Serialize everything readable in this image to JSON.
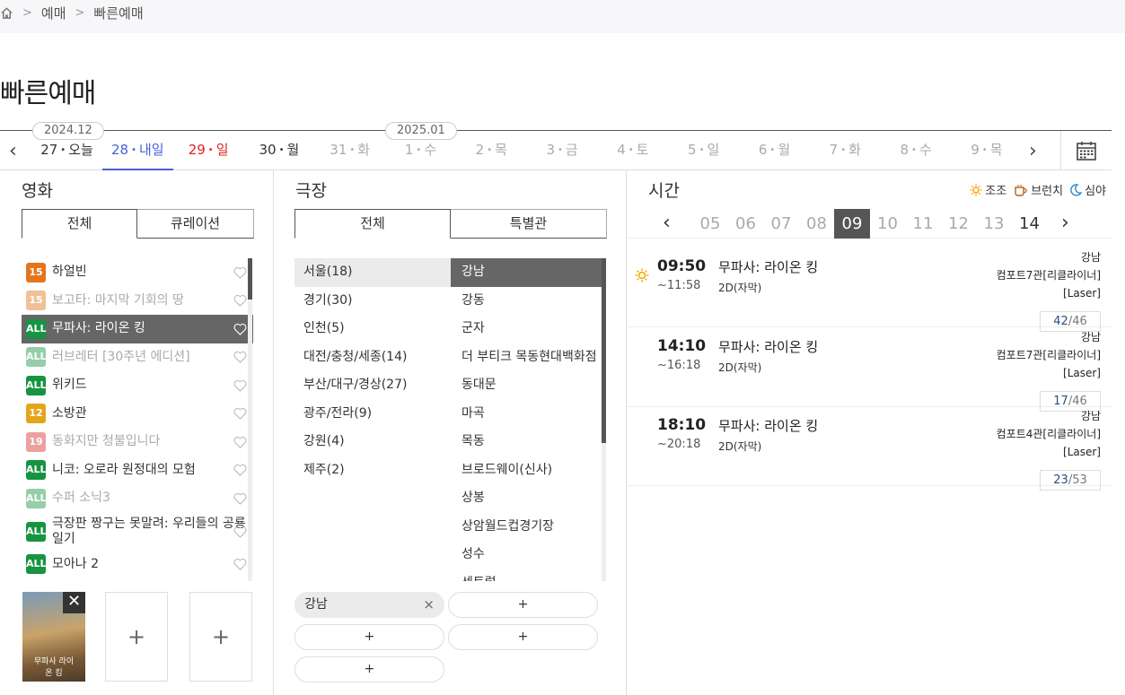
{
  "breadcrumb": [
    "예매",
    "빠른예매"
  ],
  "page_title": "빠른예매",
  "date_strip": {
    "months": [
      "2024.12",
      "2025.01"
    ],
    "days": [
      {
        "num": "27",
        "dow": "오늘",
        "state": "normal"
      },
      {
        "num": "28",
        "dow": "내일",
        "state": "sel"
      },
      {
        "num": "29",
        "dow": "일",
        "state": "sun"
      },
      {
        "num": "30",
        "dow": "월",
        "state": "normal"
      },
      {
        "num": "31",
        "dow": "화",
        "state": "dis"
      },
      {
        "num": "1",
        "dow": "수",
        "state": "dis"
      },
      {
        "num": "2",
        "dow": "목",
        "state": "dis"
      },
      {
        "num": "3",
        "dow": "금",
        "state": "dis"
      },
      {
        "num": "4",
        "dow": "토",
        "state": "dis"
      },
      {
        "num": "5",
        "dow": "일",
        "state": "dis"
      },
      {
        "num": "6",
        "dow": "월",
        "state": "dis"
      },
      {
        "num": "7",
        "dow": "화",
        "state": "dis"
      },
      {
        "num": "8",
        "dow": "수",
        "state": "dis"
      },
      {
        "num": "9",
        "dow": "목",
        "state": "dis"
      }
    ]
  },
  "movie_section": {
    "title": "영화",
    "tabs": [
      "전체",
      "큐레이션"
    ],
    "movies": [
      {
        "rating": "15",
        "name": "하얼빈",
        "state": "normal"
      },
      {
        "rating": "15",
        "name": "보고타: 마지막 기회의 땅",
        "state": "dim"
      },
      {
        "rating": "ALL",
        "name": "무파사: 라이온 킹",
        "state": "sel"
      },
      {
        "rating": "ALL",
        "name": "러브레터 [30주년 에디션]",
        "state": "dim"
      },
      {
        "rating": "ALL",
        "name": "위키드",
        "state": "normal"
      },
      {
        "rating": "12",
        "name": "소방관",
        "state": "normal"
      },
      {
        "rating": "19",
        "name": "동화지만 청불입니다",
        "state": "dim"
      },
      {
        "rating": "ALL",
        "name": "니코: 오로라 원정대의 모험",
        "state": "normal"
      },
      {
        "rating": "ALL",
        "name": "수퍼 소닉3",
        "state": "dim"
      },
      {
        "rating": "ALL",
        "name": "극장판 짱구는 못말려: 우리들의 공룡일기",
        "state": "normal"
      },
      {
        "rating": "ALL",
        "name": "모아나 2",
        "state": "normal"
      }
    ],
    "poster_title": "무파사 라이온 킹",
    "close_label": "✕",
    "add_label": "+"
  },
  "theater_section": {
    "title": "극장",
    "tabs": [
      "전체",
      "특별관"
    ],
    "regions": [
      "서울(18)",
      "경기(30)",
      "인천(5)",
      "대전/충청/세종(14)",
      "부산/대구/경상(27)",
      "광주/전라(9)",
      "강원(4)",
      "제주(2)"
    ],
    "branches": [
      "강남",
      "강동",
      "군자",
      "더 부티크 목동현대백화점",
      "동대문",
      "마곡",
      "목동",
      "브로드웨이(신사)",
      "상봉",
      "상암월드컵경기장",
      "성수",
      "센트럴"
    ],
    "selected_chip": "강남",
    "chip_remove": "×",
    "add_label": "+"
  },
  "time_section": {
    "title": "시간",
    "legend": [
      "조조",
      "브런치",
      "심야"
    ],
    "hours": [
      "05",
      "06",
      "07",
      "08",
      "09",
      "10",
      "11",
      "12",
      "13",
      "14"
    ],
    "showings": [
      {
        "start": "09:50",
        "end": "~11:58",
        "title": "무파사: 라이온 킹",
        "format": "2D(자막)",
        "branch": "강남",
        "screen": "컴포트7관[리클라이너]",
        "tag": "[Laser]",
        "remain": "42",
        "total": "/46",
        "morning": true
      },
      {
        "start": "14:10",
        "end": "~16:18",
        "title": "무파사: 라이온 킹",
        "format": "2D(자막)",
        "branch": "강남",
        "screen": "컴포트7관[리클라이너]",
        "tag": "[Laser]",
        "remain": "17",
        "total": "/46",
        "morning": false
      },
      {
        "start": "18:10",
        "end": "~20:18",
        "title": "무파사: 라이온 킹",
        "format": "2D(자막)",
        "branch": "강남",
        "screen": "컴포트4관[리클라이너]",
        "tag": "[Laser]",
        "remain": "23",
        "total": "/53",
        "morning": false
      }
    ]
  },
  "colors": {
    "selected_date": "#4a5fd8",
    "sunday": "#e02020",
    "rating_all": "#179442",
    "rating_15": "#e4751b",
    "rating_12": "#e5a51b",
    "rating_19": "#d72e2e"
  }
}
